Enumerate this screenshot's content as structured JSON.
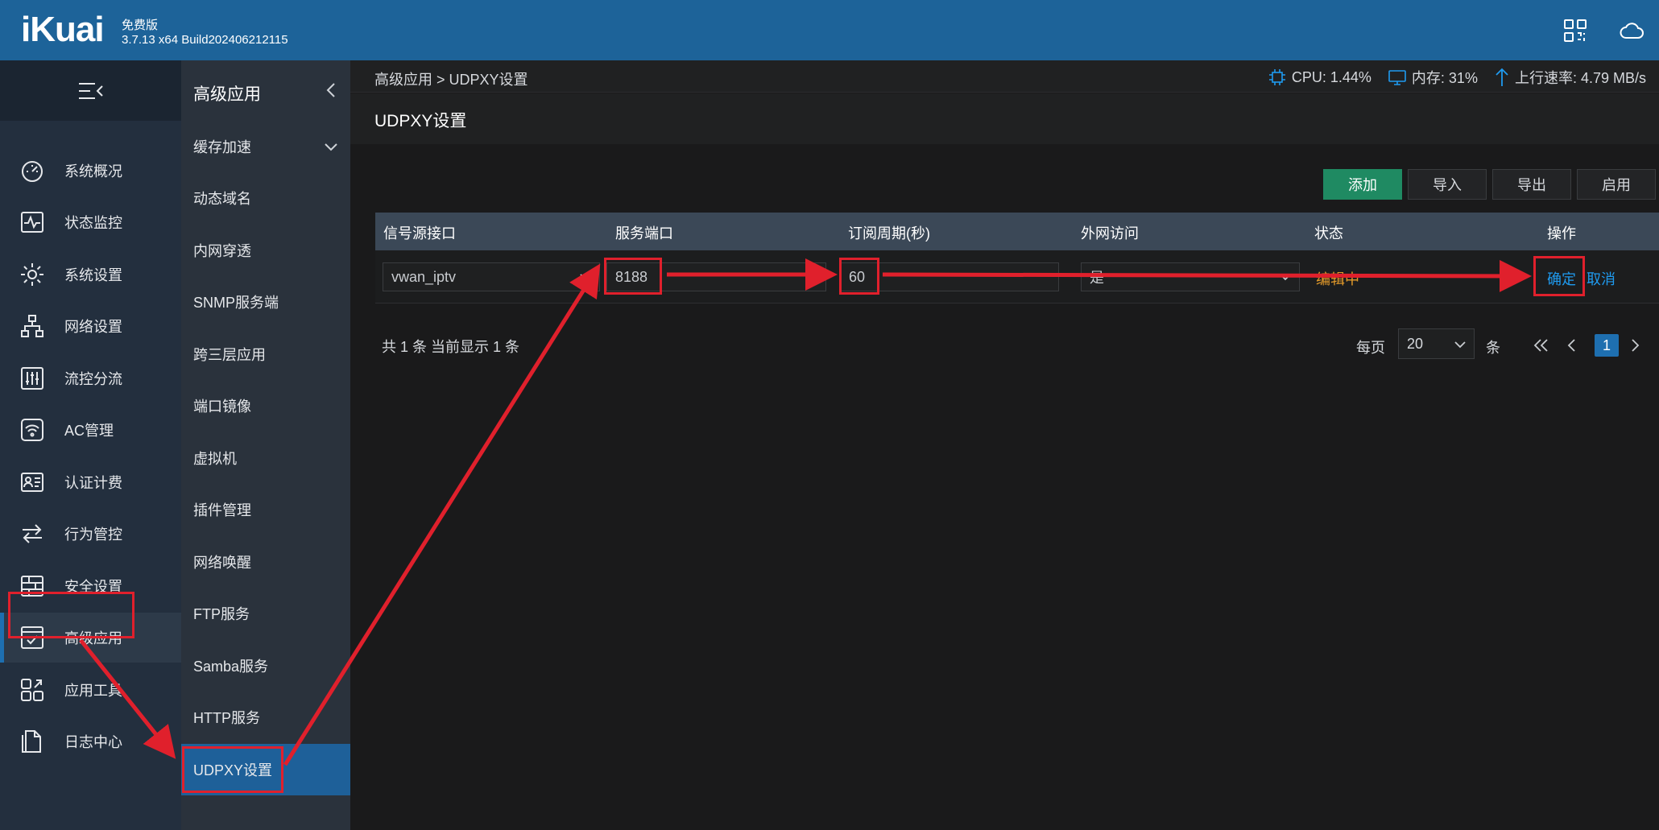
{
  "header": {
    "logo": "iKuai",
    "edition": "免费版",
    "build": "3.7.13 x64 Build202406212115",
    "icons": [
      "qr-grid-icon",
      "cloud-icon"
    ]
  },
  "nav": {
    "items": [
      {
        "label": "系统概况",
        "icon": "dashboard-gauge-icon"
      },
      {
        "label": "状态监控",
        "icon": "pulse-monitor-icon"
      },
      {
        "label": "系统设置",
        "icon": "gear-icon"
      },
      {
        "label": "网络设置",
        "icon": "network-tree-icon"
      },
      {
        "label": "流控分流",
        "icon": "sliders-icon"
      },
      {
        "label": "AC管理",
        "icon": "wifi-icon"
      },
      {
        "label": "认证计费",
        "icon": "id-card-icon"
      },
      {
        "label": "行为管控",
        "icon": "swap-arrows-icon"
      },
      {
        "label": "安全设置",
        "icon": "firewall-icon"
      },
      {
        "label": "高级应用",
        "icon": "checklist-icon",
        "active": true
      },
      {
        "label": "应用工具",
        "icon": "tools-grid-icon"
      },
      {
        "label": "日志中心",
        "icon": "document-icon"
      }
    ]
  },
  "subnav": {
    "title": "高级应用",
    "items": [
      {
        "label": "缓存加速",
        "expandable": true
      },
      {
        "label": "动态域名"
      },
      {
        "label": "内网穿透"
      },
      {
        "label": "SNMP服务端"
      },
      {
        "label": "跨三层应用"
      },
      {
        "label": "端口镜像"
      },
      {
        "label": "虚拟机"
      },
      {
        "label": "插件管理"
      },
      {
        "label": "网络唤醒"
      },
      {
        "label": "FTP服务"
      },
      {
        "label": "Samba服务"
      },
      {
        "label": "HTTP服务"
      },
      {
        "label": "UDPXY设置",
        "active": true
      }
    ]
  },
  "topbar": {
    "breadcrumb": "高级应用 > UDPXY设置",
    "cpu": "CPU: 1.44%",
    "mem": "内存: 31%",
    "up": "上行速率: 4.79 MB/s"
  },
  "page": {
    "title": "UDPXY设置",
    "buttons": {
      "add": "添加",
      "import": "导入",
      "export": "导出",
      "enable": "启用"
    },
    "table": {
      "headers": [
        "信号源接口",
        "服务端口",
        "订阅周期(秒)",
        "外网访问",
        "状态",
        "操作"
      ],
      "row": {
        "interface": "vwan_iptv",
        "port": "8188",
        "period": "60",
        "external": "是",
        "status": "编辑中",
        "confirm": "确定",
        "cancel": "取消"
      }
    },
    "pagination": {
      "total": "共 1 条 当前显示 1 条",
      "per_page_label": "每页",
      "per_page": "20",
      "unit": "条",
      "current": "1"
    }
  },
  "colors": {
    "header": "#1d6399",
    "nav": "#232f3e",
    "accent": "#1e6fb0",
    "primary_button": "#1f8a62",
    "status": "#e39a2a",
    "link": "#1f9bf0",
    "annotation": "#e0202c"
  }
}
